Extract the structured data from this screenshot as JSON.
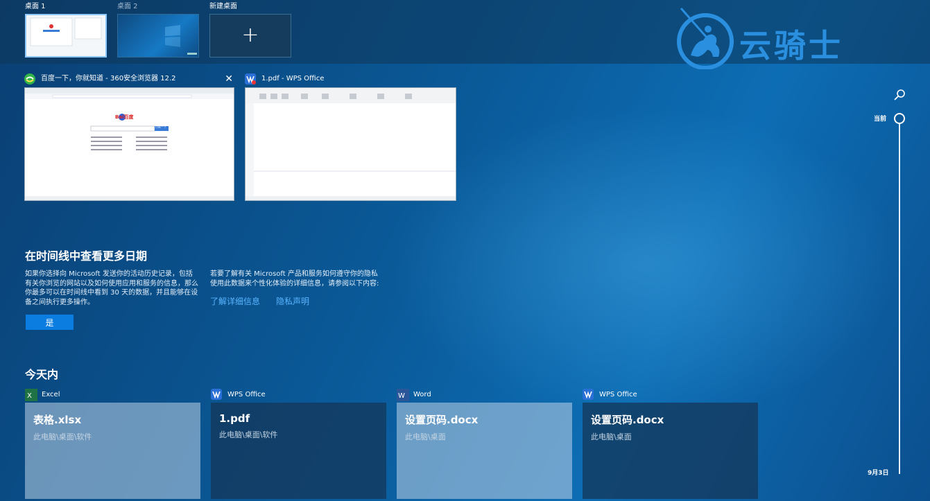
{
  "desktops": [
    {
      "label": "桌面 1",
      "active": true
    },
    {
      "label": "桌面 2",
      "active": false
    }
  ],
  "new_desktop": {
    "label": "新建桌面",
    "plus": "+"
  },
  "brand": {
    "text": "云骑士"
  },
  "windows": [
    {
      "title": "百度一下，你就知道 - 360安全浏览器 12.2",
      "close": "✕",
      "thumb_logo": "Bai百度",
      "thumb_button": "百度一下",
      "icon": "360-browser-icon"
    },
    {
      "title": "1.pdf - WPS Office",
      "icon": "wps-pdf-icon"
    }
  ],
  "timeline_promo": {
    "heading": "在时间线中查看更多日期",
    "body_left": "如果你选择向 Microsoft 发送你的活动历史记录，包括有关你浏览的网站以及如何使用应用和服务的信息，那么你最多可以在时间线中看到 30 天的数据，并且能够在设备之间执行更多操作。",
    "body_right": "若要了解有关 Microsoft 产品和服务如何遵守你的隐私使用此数据来个性化体验的详细信息，请参阅以下内容:",
    "link_learn": "了解详细信息",
    "link_privacy": "隐私声明",
    "yes_button": "是"
  },
  "today": {
    "heading": "今天内",
    "activities": [
      {
        "app": "Excel",
        "title": "表格.xlsx",
        "path": "此电脑\\桌面\\软件",
        "style": "light",
        "icon": "excel-icon"
      },
      {
        "app": "WPS Office",
        "title": "1.pdf",
        "path": "此电脑\\桌面\\软件",
        "style": "dark",
        "icon": "wps-icon"
      },
      {
        "app": "Word",
        "title": "设置页码.docx",
        "path": "此电脑\\桌面",
        "style": "light",
        "icon": "word-icon"
      },
      {
        "app": "WPS Office",
        "title": "设置页码.docx",
        "path": "此电脑\\桌面",
        "style": "dark",
        "icon": "wps-icon"
      }
    ]
  },
  "timeline": {
    "current_label": "当前",
    "date_label": "9月3日"
  },
  "colors": {
    "accent": "#0b7de0",
    "link": "#5ab5ff",
    "brand": "#2b8fe0"
  }
}
